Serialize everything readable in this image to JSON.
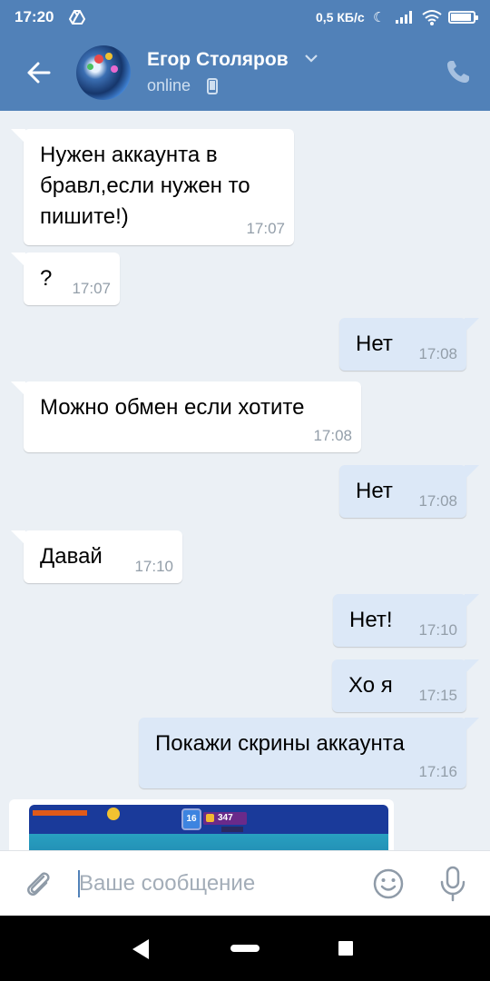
{
  "status_bar": {
    "time": "17:20",
    "speed": "0,5 КБ/с",
    "battery_level": 0.9
  },
  "header": {
    "name": "Егор Столяров",
    "status": "online"
  },
  "messages": [
    {
      "direction": "in",
      "lines": [
        "Нужен аккаунта в",
        "бравл,если нужен то",
        "пишите!)"
      ],
      "time": "17:07"
    },
    {
      "direction": "in",
      "lines": [
        "?"
      ],
      "time": "17:07"
    },
    {
      "direction": "out",
      "lines": [
        "Нет"
      ],
      "time": "17:08"
    },
    {
      "direction": "in",
      "lines": [
        "Можно обмен если хотите"
      ],
      "time": "17:08"
    },
    {
      "direction": "out",
      "lines": [
        "Нет"
      ],
      "time": "17:08"
    },
    {
      "direction": "in",
      "lines": [
        "Давай"
      ],
      "time": "17:10"
    },
    {
      "direction": "out",
      "lines": [
        "Нет!"
      ],
      "time": "17:10"
    },
    {
      "direction": "out",
      "lines": [
        "Хо я"
      ],
      "time": "17:15"
    },
    {
      "direction": "out",
      "lines": [
        "Покажи скрины аккаунта"
      ],
      "time": "17:16"
    }
  ],
  "image_preview": {
    "badge": "16",
    "trophies": "347"
  },
  "input": {
    "placeholder": "Ваше сообщение",
    "value": ""
  },
  "icons": {
    "back": "arrow-left-icon",
    "call": "phone-icon",
    "attach": "paperclip-icon",
    "emoji": "smile-icon",
    "mic": "microphone-icon"
  },
  "colors": {
    "accent": "#5181b8",
    "background": "#ebf0f5",
    "outgoing": "#dce8f7",
    "incoming": "#ffffff"
  }
}
